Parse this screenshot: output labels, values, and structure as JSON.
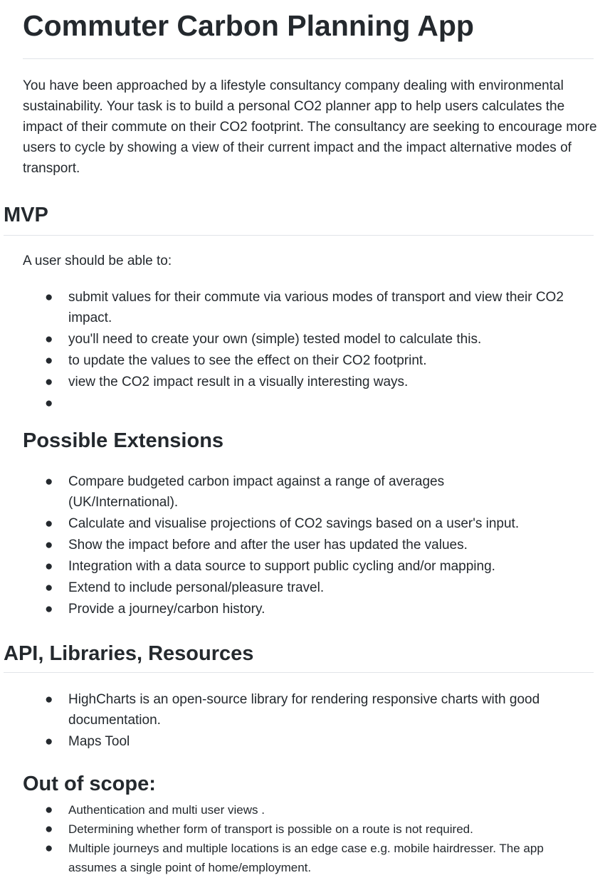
{
  "title": "Commuter Carbon Planning App",
  "intro": "You have been approached by a lifestyle consultancy company dealing with environmental sustainability. Your task is to build a personal CO2 planner app to help users calculates the impact of their commute on their CO2 footprint. The consultancy are seeking to encourage more users to cycle by showing a view of their current impact and the impact alternative modes of transport.",
  "mvp": {
    "heading": "MVP",
    "lead": "A user should be able to:",
    "items": [
      "submit values for their commute via various modes of transport and view their CO2 impact.",
      "you'll need to create your own (simple) tested model to calculate this.",
      "to update the values to see the effect on their CO2 footprint.",
      "view the CO2 impact result in a visually interesting ways.",
      ""
    ]
  },
  "extensions": {
    "heading": "Possible Extensions",
    "items": [
      "Compare budgeted carbon impact against a range of averages (UK/International).",
      "Calculate and visualise projections of CO2 savings based on a user's input.",
      "Show the impact before and after the user has updated the values.",
      "Integration with a data source to support public cycling and/or mapping.",
      "Extend to include personal/pleasure travel.",
      "Provide a journey/carbon history."
    ]
  },
  "resources": {
    "heading": "API, Libraries, Resources",
    "items": [
      "HighCharts is an open-source library for rendering responsive charts with good documentation.",
      "Maps Tool"
    ]
  },
  "out_of_scope": {
    "heading": "Out of scope:",
    "items": [
      "Authentication and multi user views .",
      "Determining whether form of transport is possible on a route is not required.",
      "Multiple journeys and multiple locations is an edge case e.g. mobile hairdresser. The app assumes a single point of home/employment."
    ]
  }
}
